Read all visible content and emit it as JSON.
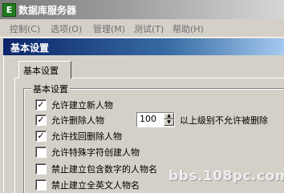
{
  "app": {
    "icon_letter": "E",
    "title": "数据库服务器"
  },
  "menu": [
    {
      "label": "控制(C)"
    },
    {
      "label": "选项(O)"
    },
    {
      "label": "管理(M)"
    },
    {
      "label": "测试(T)"
    },
    {
      "label": "帮助(H)"
    }
  ],
  "dialog": {
    "title": "基本设置",
    "tab_label": "基本设置",
    "group_label": "基本设置",
    "options": [
      {
        "label": "允许建立新人物",
        "checked": true,
        "mark": "✓"
      },
      {
        "label": "允许删除人物",
        "checked": true,
        "mark": "✓"
      },
      {
        "label": "允许找回删除人物",
        "checked": true,
        "mark": "✓"
      },
      {
        "label": "允许特殊字符创建人物",
        "checked": false,
        "mark": ""
      },
      {
        "label": "禁止建立包含数字的人物名",
        "checked": false,
        "mark": ""
      },
      {
        "label": "禁止建立全英文人物名",
        "checked": false,
        "mark": ""
      }
    ],
    "level_value": "100",
    "level_note": "以上级别不允许被删除"
  },
  "watermark": "bbs.108pc.com"
}
